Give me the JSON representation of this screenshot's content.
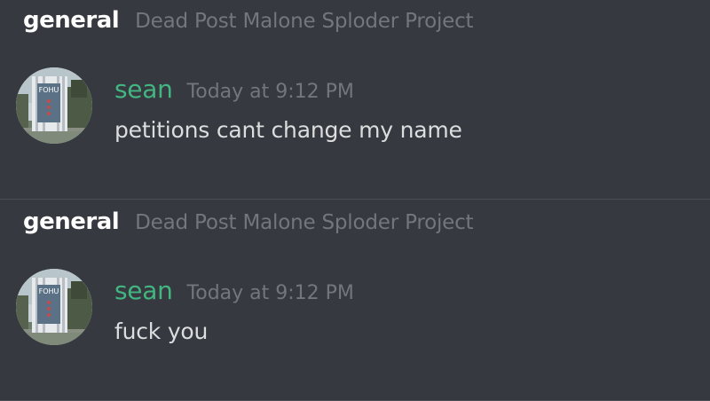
{
  "messages": [
    {
      "channel": "general",
      "server": "Dead Post Malone Sploder Project",
      "author": "sean",
      "timestamp": "Today at 9:12 PM",
      "text": "petitions cant change my name",
      "avatar_sign": "FOHU"
    },
    {
      "channel": "general",
      "server": "Dead Post Malone Sploder Project",
      "author": "sean",
      "timestamp": "Today at 9:12 PM",
      "text": "fuck you",
      "avatar_sign": "FOHU"
    }
  ],
  "colors": {
    "background": "#36393f",
    "author": "#43b581",
    "muted": "#72767d",
    "message_text": "#dcddde",
    "channel": "#ffffff"
  }
}
